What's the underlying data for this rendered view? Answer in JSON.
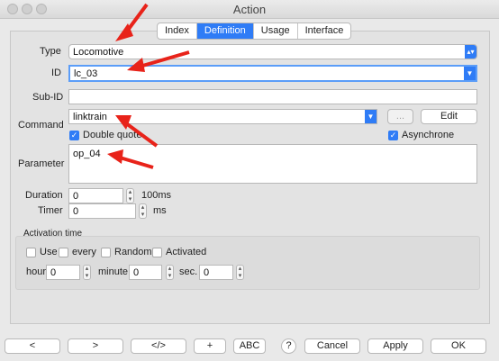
{
  "window": {
    "title": "Action"
  },
  "tabs": [
    "Index",
    "Definition",
    "Usage",
    "Interface"
  ],
  "form": {
    "type_label": "Type",
    "type_value": "Locomotive",
    "id_label": "ID",
    "id_value": "lc_03",
    "subid_label": "Sub-ID",
    "subid_value": "",
    "command_label": "Command",
    "command_value": "linktrain",
    "ellipsis_label": "...",
    "edit_label": "Edit",
    "double_quote_label": "Double quote",
    "asynchrone_label": "Asynchrone",
    "parameter_label": "Parameter",
    "parameter_value": "op_04",
    "duration_label": "Duration",
    "duration_value": "0",
    "duration_unit": "100ms",
    "timer_label": "Timer",
    "timer_value": "0",
    "timer_unit": "ms"
  },
  "activation": {
    "title": "Activation time",
    "use_label": "Use",
    "every_label": "every",
    "random_label": "Random",
    "activated_label": "Activated",
    "hour_label": "hour",
    "hour_value": "0",
    "minute_label": "minute",
    "minute_value": "0",
    "sec_label": "sec.",
    "sec_value": "0"
  },
  "buttons": {
    "prev": "<",
    "next": ">",
    "code": "</>",
    "add": "+",
    "abc": "ABC",
    "help": "?",
    "cancel": "Cancel",
    "apply": "Apply",
    "ok": "OK"
  },
  "colors": {
    "accent": "#2f7cf6",
    "annotation_arrow": "#e8231a"
  }
}
